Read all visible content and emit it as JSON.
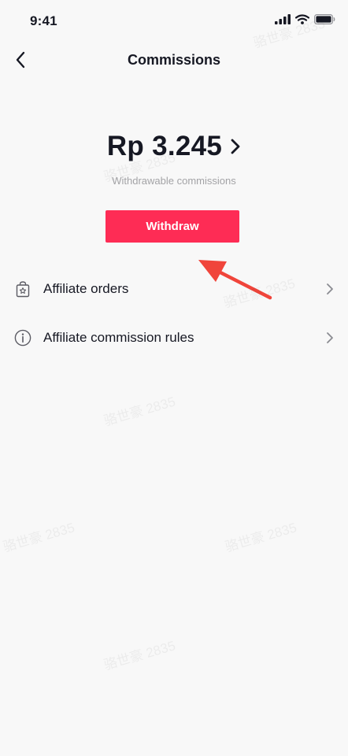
{
  "status_bar": {
    "time": "9:41",
    "signal_icon": "signal-icon",
    "wifi_icon": "wifi-icon",
    "battery_icon": "battery-icon"
  },
  "nav": {
    "title": "Commissions",
    "back_icon": "chevron-left-icon"
  },
  "balance": {
    "amount": "Rp 3.245",
    "caption": "Withdrawable commissions",
    "chevron_icon": "chevron-right-icon"
  },
  "withdraw_button": {
    "label": "Withdraw",
    "color": "#fe2c55"
  },
  "menu": [
    {
      "label": "Affiliate orders",
      "icon": "shopping-bag-icon"
    },
    {
      "label": "Affiliate commission rules",
      "icon": "info-icon"
    }
  ],
  "annotation": {
    "arrow_color": "#f0453b"
  },
  "watermark": {
    "text": "骆世豪 2835"
  }
}
